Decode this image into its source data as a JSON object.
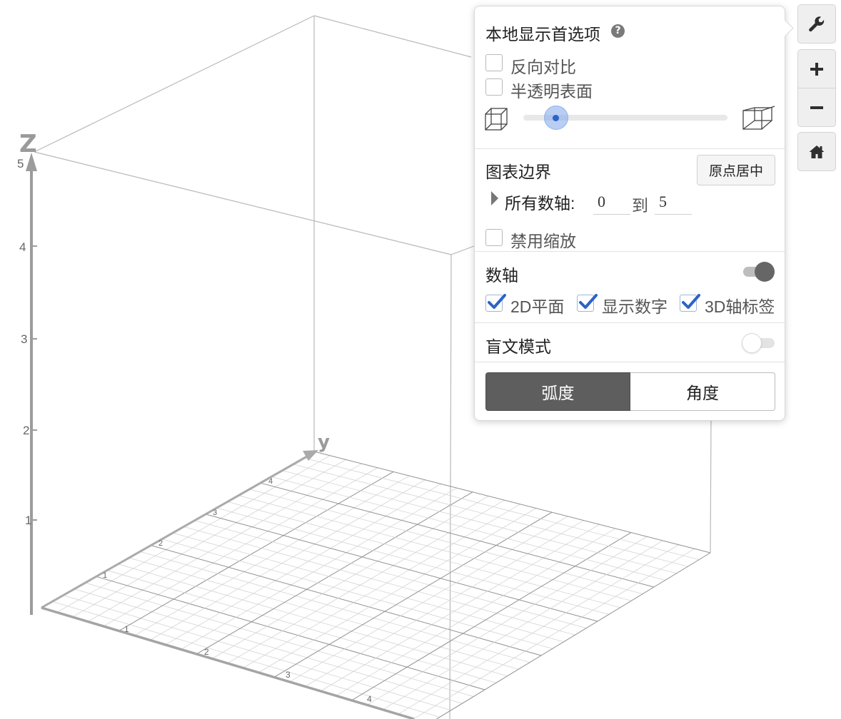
{
  "graph": {
    "z_axis_label": "Z",
    "y_axis_label": "y",
    "z_ticks": [
      "5",
      "4",
      "3",
      "2",
      "1"
    ],
    "y_ticks": [
      "4",
      "3",
      "2",
      "1"
    ],
    "x_ticks": [
      "1",
      "2",
      "3",
      "4"
    ]
  },
  "toolbar": {
    "settings_icon": "wrench-icon",
    "zoom_in_icon": "plus-icon",
    "zoom_out_icon": "minus-icon",
    "home_icon": "home-icon"
  },
  "panel": {
    "title": "本地显示首选项",
    "help_glyph": "?",
    "reverse_contrast": {
      "label": "反向对比",
      "checked": false
    },
    "translucent_surfaces": {
      "label": "半透明表面",
      "checked": false
    },
    "projection_slider": {
      "value": 0.16,
      "left_icon": "orthographic-cube-icon",
      "right_icon": "perspective-cube-icon"
    },
    "bounds": {
      "title": "图表边界",
      "center_origin_label": "原点居中",
      "all_axes_label": "所有数轴:",
      "min": "0",
      "to_label": "到",
      "max": "5",
      "disable_zoom": {
        "label": "禁用缩放",
        "checked": false
      }
    },
    "axes": {
      "title": "数轴",
      "enabled": true,
      "plane_2d": {
        "label": "2D平面",
        "checked": true
      },
      "show_numbers": {
        "label": "显示数字",
        "checked": true
      },
      "axis_labels_3d": {
        "label": "3D轴标签",
        "checked": true
      }
    },
    "braille": {
      "title": "盲文模式",
      "enabled": false
    },
    "angle_mode": {
      "radians_label": "弧度",
      "degrees_label": "角度",
      "selected": "radians"
    }
  },
  "colors": {
    "accent_blue": "#2c63c6",
    "toggle_on": "#666666",
    "segment_selected_bg": "#5e5e5e"
  }
}
